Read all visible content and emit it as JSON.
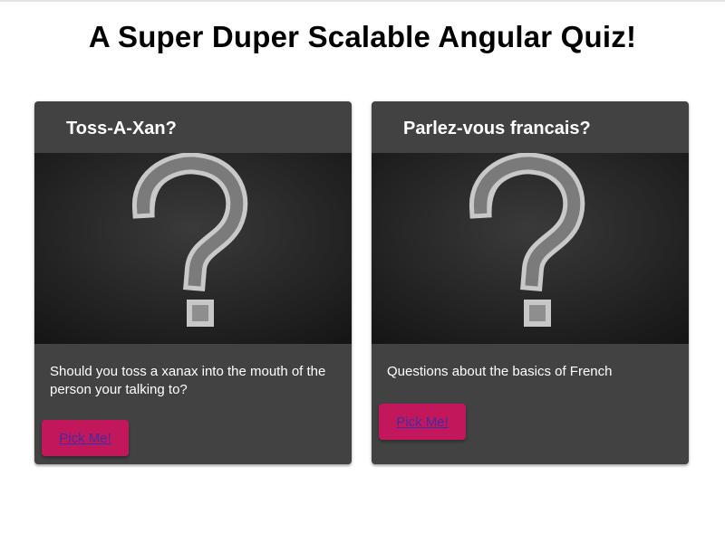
{
  "header": {
    "title": "A Super Duper Scalable Angular Quiz!"
  },
  "quizzes": [
    {
      "title": "Toss-A-Xan?",
      "description": "Should you toss a xanax into the mouth of the person your talking to?",
      "button_label": "Pick Me!",
      "image_icon": "question-mark-chalkboard-icon"
    },
    {
      "title": "Parlez-vous francais?",
      "description": "Questions about the basics of French",
      "button_label": "Pick Me!",
      "image_icon": "question-mark-chalkboard-icon"
    }
  ],
  "colors": {
    "card_background": "#424242",
    "button_background": "#c2185b",
    "button_text": "#3a2fa8",
    "chalkboard": "#232323"
  }
}
